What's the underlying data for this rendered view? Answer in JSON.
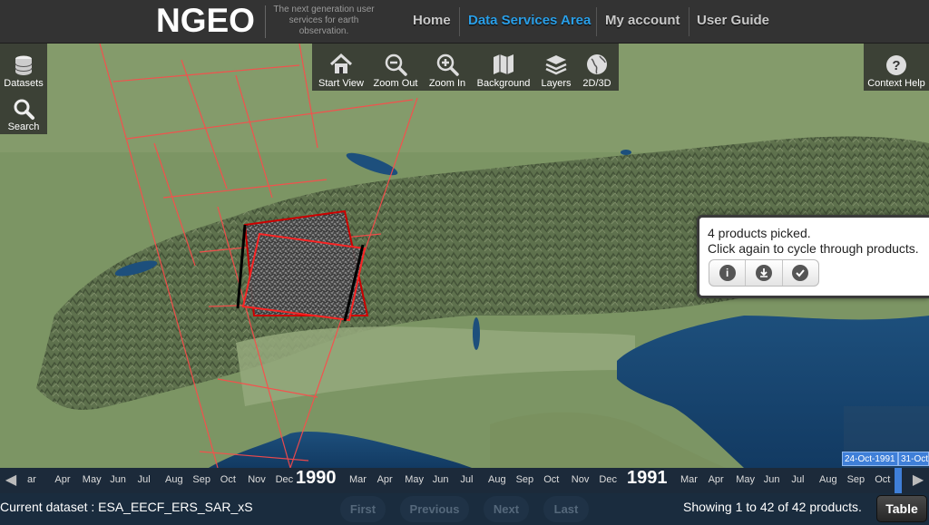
{
  "header": {
    "logo": "NGEO",
    "tagline": "The next generation user services for earth observation.",
    "nav": [
      {
        "label": "Home",
        "active": false
      },
      {
        "label": "Data Services Area",
        "active": true
      },
      {
        "label": "My account",
        "active": false
      },
      {
        "label": "User Guide",
        "active": false
      }
    ]
  },
  "left_toolbar": {
    "datasets_label": "Datasets",
    "search_label": "Search"
  },
  "map_toolbar": {
    "items": [
      {
        "label": "Start View",
        "icon": "home-icon"
      },
      {
        "label": "Zoom Out",
        "icon": "zoom-out-icon"
      },
      {
        "label": "Zoom In",
        "icon": "zoom-in-icon"
      },
      {
        "label": "Background",
        "icon": "map-icon"
      },
      {
        "label": "Layers",
        "icon": "layers-icon"
      },
      {
        "label": "2D/3D",
        "icon": "globe-icon"
      }
    ]
  },
  "context_help": {
    "label": "Context Help"
  },
  "popup": {
    "line1": "4 products picked.",
    "line2": "Click again to cycle through products.",
    "buttons": [
      "info-icon",
      "download-icon",
      "check-icon"
    ]
  },
  "timeline": {
    "left_months": [
      "ar",
      "Apr",
      "May",
      "Jun",
      "Jul",
      "Aug",
      "Sep",
      "Oct",
      "Nov",
      "Dec"
    ],
    "year1": "1990",
    "mid_months": [
      "Mar",
      "Apr",
      "May",
      "Jun",
      "Jul",
      "Aug",
      "Sep",
      "Oct",
      "Nov",
      "Dec"
    ],
    "year2": "1991",
    "right_months": [
      "Mar",
      "Apr",
      "May",
      "Jun",
      "Jul",
      "Aug",
      "Sep",
      "Oct"
    ],
    "range_start": "24-Oct-1991",
    "range_end": "31-Oct"
  },
  "footer": {
    "current_dataset": "Current dataset : ESA_EECF_ERS_SAR_xS",
    "pager": {
      "first": "First",
      "previous": "Previous",
      "next": "Next",
      "last": "Last"
    },
    "showing": "Showing 1 to 42 of 42 products.",
    "table_button": "Table"
  },
  "colors": {
    "accent": "#2a9fe8",
    "header_bg": "#333333",
    "footprint": "#ff4444",
    "selected": "#cc0000"
  }
}
